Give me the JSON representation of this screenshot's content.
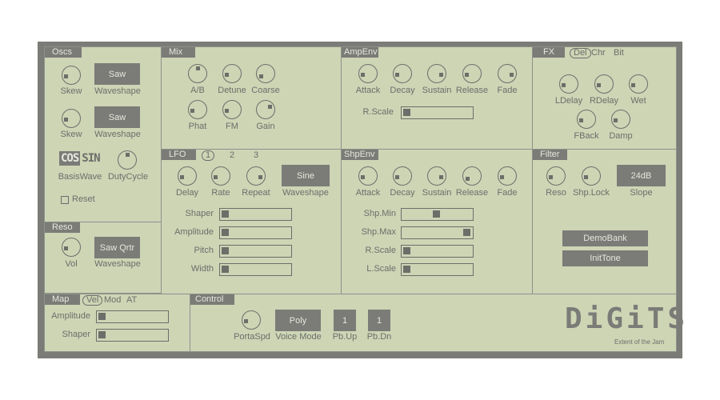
{
  "colors": {
    "panel": "#cdd5b5",
    "frame": "#7b7b77",
    "ink": "#6d6e6a",
    "button_text": "#e6e8dd"
  },
  "oscs": {
    "title": "Oscs",
    "knobs": [
      {
        "label": "Skew",
        "value": 0.1
      },
      {
        "label": "Skew",
        "value": 0.1
      }
    ],
    "waveshapes": [
      {
        "value": "Saw",
        "label": "Waveshape"
      },
      {
        "value": "Saw",
        "label": "Waveshape"
      }
    ],
    "basis": {
      "options": [
        "COS",
        "SIN"
      ],
      "selected": "COS",
      "label": "BasisWave"
    },
    "duty": {
      "label": "DutyCycle",
      "value": 0.55
    },
    "reset": {
      "label": "Reset",
      "checked": false
    }
  },
  "reso": {
    "title": "Reso",
    "knob": {
      "label": "Vol",
      "value": 0.1
    },
    "waveshape": {
      "value": "Saw Qrtr",
      "label": "Waveshape"
    }
  },
  "mix": {
    "title": "Mix",
    "knobs": [
      {
        "label": "A/B",
        "value": 0.55
      },
      {
        "label": "Detune",
        "value": 0.1
      },
      {
        "label": "Coarse",
        "value": 0.0
      },
      {
        "label": "Phat",
        "value": 0.1
      },
      {
        "label": "FM",
        "value": 0.1
      },
      {
        "label": "Gain",
        "value": 0.75
      }
    ]
  },
  "lfo": {
    "title": "LFO",
    "tabs": [
      "1",
      "2",
      "3"
    ],
    "selected_tab": "1",
    "knobs": [
      {
        "label": "Delay",
        "value": 0.1
      },
      {
        "label": "Rate",
        "value": 0.1
      },
      {
        "label": "Repeat",
        "value": 0.9
      }
    ],
    "waveshape": {
      "value": "Sine",
      "label": "Waveshape"
    },
    "sliders": [
      {
        "label": "Shaper",
        "value": 0.0
      },
      {
        "label": "Amplitude",
        "value": 0.0
      },
      {
        "label": "Pitch",
        "value": 0.0
      },
      {
        "label": "Width",
        "value": 0.0
      }
    ]
  },
  "ampenv": {
    "title": "AmpEnv",
    "knobs": [
      {
        "label": "Attack",
        "value": 0.1
      },
      {
        "label": "Decay",
        "value": 0.1
      },
      {
        "label": "Sustain",
        "value": 0.9
      },
      {
        "label": "Release",
        "value": 0.1
      },
      {
        "label": "Fade",
        "value": 0.9
      }
    ],
    "sliders": [
      {
        "label": "R.Scale",
        "value": 0.0
      }
    ]
  },
  "shpenv": {
    "title": "ShpEnv",
    "knobs": [
      {
        "label": "Attack",
        "value": 0.1
      },
      {
        "label": "Decay",
        "value": 0.1
      },
      {
        "label": "Sustain",
        "value": 0.9
      },
      {
        "label": "Release",
        "value": 0.0
      },
      {
        "label": "Fade",
        "value": 0.1
      }
    ],
    "sliders": [
      {
        "label": "Shp.Min",
        "value": 0.5
      },
      {
        "label": "Shp.Max",
        "value": 1.0
      },
      {
        "label": "R.Scale",
        "value": 0.0
      },
      {
        "label": "L.Scale",
        "value": 0.0
      }
    ]
  },
  "fx": {
    "title": "FX",
    "tabs": [
      "Del",
      "Chr",
      "Bit"
    ],
    "selected_tab": "Del",
    "knobs": [
      {
        "label": "LDelay",
        "value": 0.1
      },
      {
        "label": "RDelay",
        "value": 0.1
      },
      {
        "label": "Wet",
        "value": 0.1
      },
      {
        "label": "FBack",
        "value": 0.1
      },
      {
        "label": "Damp",
        "value": 0.1
      }
    ]
  },
  "filter": {
    "title": "Filter",
    "knobs": [
      {
        "label": "Reso",
        "value": 0.1
      },
      {
        "label": "Shp.Lock",
        "value": 0.1
      }
    ],
    "slope": {
      "value": "24dB",
      "label": "Slope"
    },
    "buttons": [
      "DemoBank",
      "InitTone"
    ]
  },
  "map": {
    "title": "Map",
    "tabs": [
      "Vel",
      "Mod",
      "AT"
    ],
    "selected_tab": "Vel",
    "sliders": [
      {
        "label": "Amplitude",
        "value": 0.0
      },
      {
        "label": "Shaper",
        "value": 0.0
      }
    ]
  },
  "control": {
    "title": "Control",
    "porta": {
      "label": "PortaSpd",
      "value": 0.1
    },
    "voice_mode": {
      "value": "Poly",
      "label": "Voice Mode"
    },
    "pb_up": {
      "value": "1",
      "label": "Pb.Up"
    },
    "pb_dn": {
      "value": "1",
      "label": "Pb.Dn"
    }
  },
  "logo": {
    "title": "DiGiTS",
    "subtitle": "Extent of the Jam"
  }
}
